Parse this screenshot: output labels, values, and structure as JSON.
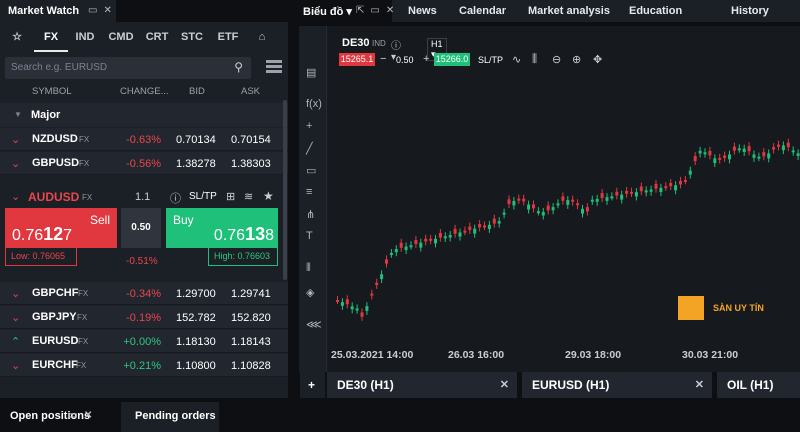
{
  "market_watch": {
    "title": "Market Watch",
    "tabs": [
      "☆",
      "FX",
      "IND",
      "CMD",
      "CRT",
      "STC",
      "ETF"
    ],
    "active_tab": "FX",
    "search_placeholder": "Search e.g. EURUSD",
    "columns": {
      "symbol": "SYMBOL",
      "change": "CHANGE...",
      "bid": "BID",
      "ask": "ASK"
    },
    "group": "Major",
    "rows_top": [
      {
        "symbol": "NZDUSD",
        "class": "FX",
        "change": "-0.63%",
        "bid": "0.70134",
        "ask": "0.70154",
        "dir": "down"
      },
      {
        "symbol": "GBPUSD",
        "class": "FX",
        "change": "-0.56%",
        "bid": "1.38278",
        "ask": "1.38303",
        "dir": "down"
      }
    ],
    "expanded": {
      "symbol": "AUDUSD",
      "class": "FX",
      "lot": "1.1",
      "sltp": "SL/TP",
      "sell_label": "Sell",
      "sell_price_pre": "0.76",
      "sell_price_big": "12",
      "sell_price_post": "7",
      "spread": "0.50",
      "buy_label": "Buy",
      "buy_price_pre": "0.76",
      "buy_price_big": "13",
      "buy_price_post": "8",
      "low": "Low: 0.76065",
      "high": "High: 0.76603",
      "change": "-0.51%"
    },
    "rows_bottom": [
      {
        "symbol": "GBPCHF",
        "class": "FX",
        "change": "-0.34%",
        "bid": "1.29700",
        "ask": "1.29741",
        "dir": "down"
      },
      {
        "symbol": "GBPJPY",
        "class": "FX",
        "change": "-0.19%",
        "bid": "152.782",
        "ask": "152.820",
        "dir": "down"
      },
      {
        "symbol": "EURUSD",
        "class": "FX",
        "change": "+0.00%",
        "bid": "1.18130",
        "ask": "1.18143",
        "dir": "up"
      },
      {
        "symbol": "EURCHF",
        "class": "FX",
        "change": "+0.21%",
        "bid": "1.10800",
        "ask": "1.10828",
        "dir": "down"
      }
    ]
  },
  "topbar": {
    "chart_label": "Biểu đồ",
    "nav": [
      "News",
      "Calendar",
      "Market analysis",
      "Education",
      "History"
    ]
  },
  "chart": {
    "symbol": "DE30",
    "class": "IND",
    "timeframe": "H1",
    "bid": "15265.1",
    "spread": "0.50",
    "ask": "15266.0",
    "sltp": "SL/TP",
    "x_labels": [
      "25.03.2021 14:00",
      "26.03 16:00",
      "29.03 18:00",
      "30.03 21:00"
    ],
    "watermark": "SÀN UY TÍN"
  },
  "chart_tabs": [
    "DE30 (H1)",
    "EURUSD (H1)",
    "OIL (H1)"
  ],
  "bottom": {
    "open_positions": "Open positions",
    "pending_orders": "Pending orders"
  },
  "colors": {
    "red": "#e0383e",
    "green": "#1ec07a",
    "panel": "#1b1f26"
  }
}
